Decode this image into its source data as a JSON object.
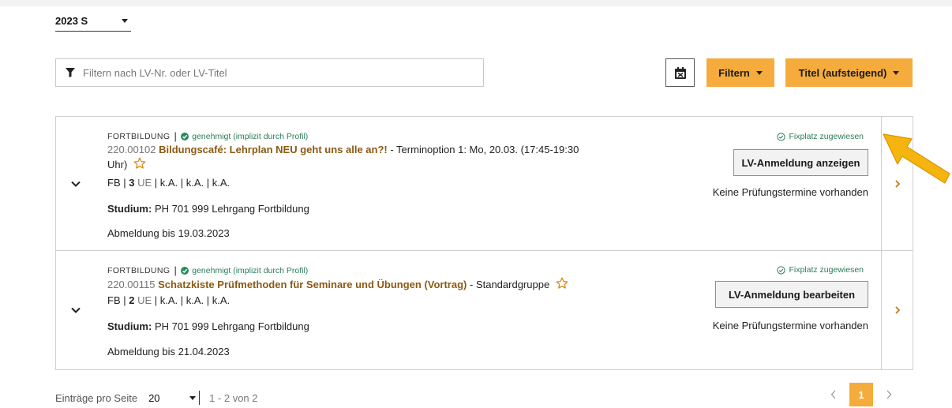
{
  "semester": {
    "value": "2023 S"
  },
  "filter": {
    "placeholder": "Filtern nach LV-Nr. oder LV-Titel"
  },
  "toolbar": {
    "filter_label": "Filtern",
    "sort_label": "Titel (aufsteigend)"
  },
  "courses": [
    {
      "category": "FORTBILDUNG",
      "approval": "genehmigt (implizit durch Profil)",
      "number": "220.00102",
      "title": "Bildungscafé: Lehrplan NEU geht uns alle an?!",
      "suffix_line1": " - Terminoption 1: Mo, 20.03. (17:45-19:30",
      "suffix_line2": "Uhr)",
      "type": "FB",
      "hours": "3",
      "unit": "UE",
      "details": "k.A. | k.A. | k.A.",
      "study_label": "Studium:",
      "study_value": "PH 701 999 Lehrgang Fortbildung",
      "deregister": "Abmeldung bis 19.03.2023",
      "status": "Fixplatz zugewiesen",
      "action": "LV-Anmeldung anzeigen",
      "exams": "Keine Prüfungstermine vorhanden"
    },
    {
      "category": "FORTBILDUNG",
      "approval": "genehmigt (implizit durch Profil)",
      "number": "220.00115",
      "title": "Schatzkiste Prüfmethoden für Seminare und Übungen (Vortrag)",
      "suffix_line1": " - Standardgruppe",
      "type": "FB",
      "hours": "2",
      "unit": "UE",
      "details": "k.A. | k.A. | k.A.",
      "study_label": "Studium:",
      "study_value": "PH 701 999 Lehrgang Fortbildung",
      "deregister": "Abmeldung bis 21.04.2023",
      "status": "Fixplatz zugewiesen",
      "action": "LV-Anmeldung bearbeiten",
      "exams": "Keine Prüfungstermine vorhanden"
    }
  ],
  "pagination": {
    "per_page_label": "Einträge pro Seite",
    "per_page_value": "20",
    "range": "1 - 2 von 2",
    "current_page": "1"
  },
  "colors": {
    "accent": "#f5ac3c",
    "title_brown": "#8b5a12",
    "success_green": "#2a7d58",
    "annotation_arrow": "#f6b40e"
  }
}
